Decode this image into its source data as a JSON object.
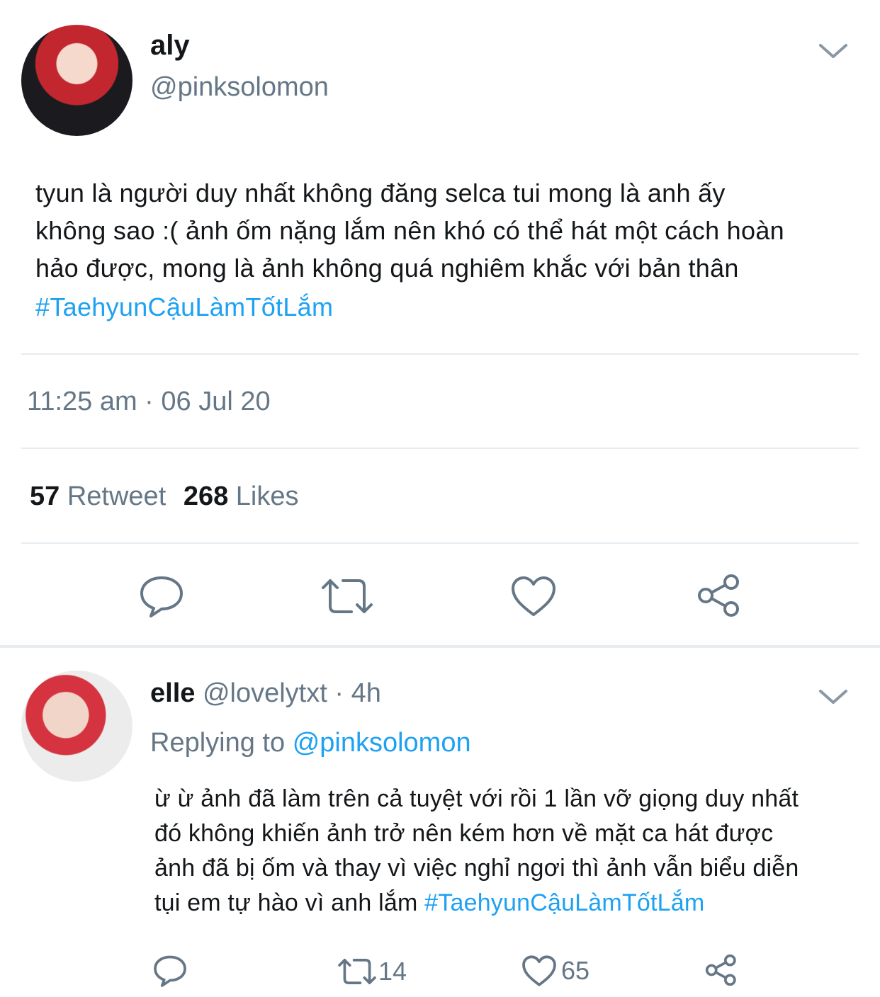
{
  "main_tweet": {
    "display_name": "aly",
    "handle": "@pinksolomon",
    "text_lines": [
      "tyun là người duy nhất không đăng selca tui mong là anh ấy",
      "không sao :( ảnh ốm nặng lắm nên khó có thể hát một cách hoàn",
      "hảo được, mong là ảnh không quá nghiêm khắc với bản thân"
    ],
    "hashtag": "#TaehyunCậuLàmTốtLắm",
    "timestamp": "11:25 am · 06 Jul 20",
    "retweet_count": "57",
    "retweet_label": "Retweet",
    "like_count": "268",
    "like_label": "Likes"
  },
  "reply": {
    "display_name": "elle",
    "handle": "@lovelytxt",
    "time": "· 4h",
    "replying_label": "Replying to",
    "replying_handle": "@pinksolomon",
    "text_lines": [
      "ừ ừ ảnh đã làm trên cả tuyệt với rồi 1 lần vỡ giọng duy nhất",
      "đó không khiến ảnh trở nên kém hơn về mặt ca hát được",
      "ảnh đã bị ốm và thay vì việc nghỉ ngơi thì ảnh vẫn biểu diễn"
    ],
    "last_line_text": "tụi em tự hào vì anh lắm",
    "hashtag": "#TaehyunCậuLàmTốtLắm",
    "retweet_count": "14",
    "like_count": "65"
  },
  "icons": {
    "reply": "reply-icon",
    "retweet": "retweet-icon",
    "like": "heart-icon",
    "share": "share-icon",
    "menu": "chevron-down-icon"
  },
  "colors": {
    "link": "#1da1f2",
    "muted": "#657786",
    "text": "#14171a",
    "divider": "#e6ecf0"
  }
}
